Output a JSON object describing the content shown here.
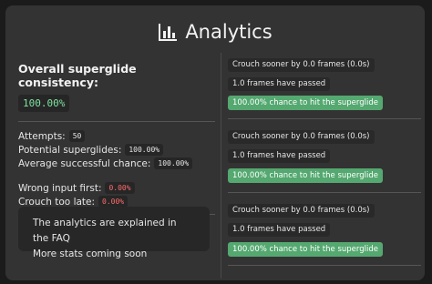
{
  "header": {
    "title": "Analytics",
    "icon": "bar-chart-icon"
  },
  "summary": {
    "heading": "Overall superglide consistency:",
    "consistency": "100.00%",
    "attempts_label": "Attempts:",
    "attempts_value": "50",
    "potential_label": "Potential superglides:",
    "potential_value": "100.00%",
    "avg_label": "Average successful chance:",
    "avg_value": "100.00%",
    "wrong_label": "Wrong input first:",
    "wrong_value": "0.00%",
    "crouch_label": "Crouch too late:",
    "crouch_value": "0.00%"
  },
  "info": {
    "line1": "The analytics are explained in the FAQ",
    "line2": "More stats coming soon"
  },
  "attempts": [
    {
      "crouch": "Crouch sooner by 0.0 frames (0.0s)",
      "frames": "1.0 frames have passed",
      "chance": "100.00% chance to hit the superglide"
    },
    {
      "crouch": "Crouch sooner by 0.0 frames (0.0s)",
      "frames": "1.0 frames have passed",
      "chance": "100.00% chance to hit the superglide"
    },
    {
      "crouch": "Crouch sooner by 0.0 frames (0.0s)",
      "frames": "1.0 frames have passed",
      "chance": "100.00% chance to hit the superglide"
    }
  ],
  "colors": {
    "panel": "#333333",
    "success": "#54a870",
    "accent_text": "#7ee4a0",
    "error_text": "#ff6b6b"
  }
}
